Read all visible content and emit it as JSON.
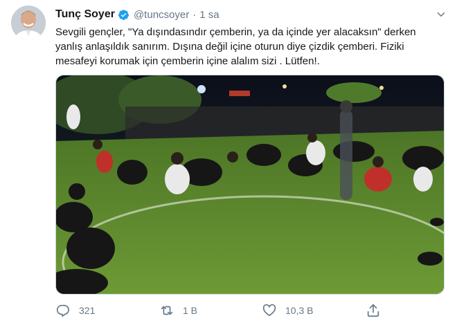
{
  "tweet": {
    "author_name": "Tunç Soyer",
    "handle": "@tuncsoyer",
    "separator": "·",
    "time": "1 sa",
    "text_lines": [
      "Sevgili gençler, \"Ya dışındasındır çemberin, ya da içinde yer alacaksın\" derken",
      "yanlış anlaşıldık sanırım. Dışına değil içine oturun diye çizdik çemberi. Fiziki",
      "mesafeyi korumak için çemberin içine alalım sizi . Lütfen!."
    ],
    "actions": {
      "reply_count": "321",
      "retweet_count": "1 B",
      "like_count": "10,3 B"
    }
  },
  "colors": {
    "verified": "#1da1f2",
    "icon": "#657786",
    "grass": "#5f8a2e"
  }
}
